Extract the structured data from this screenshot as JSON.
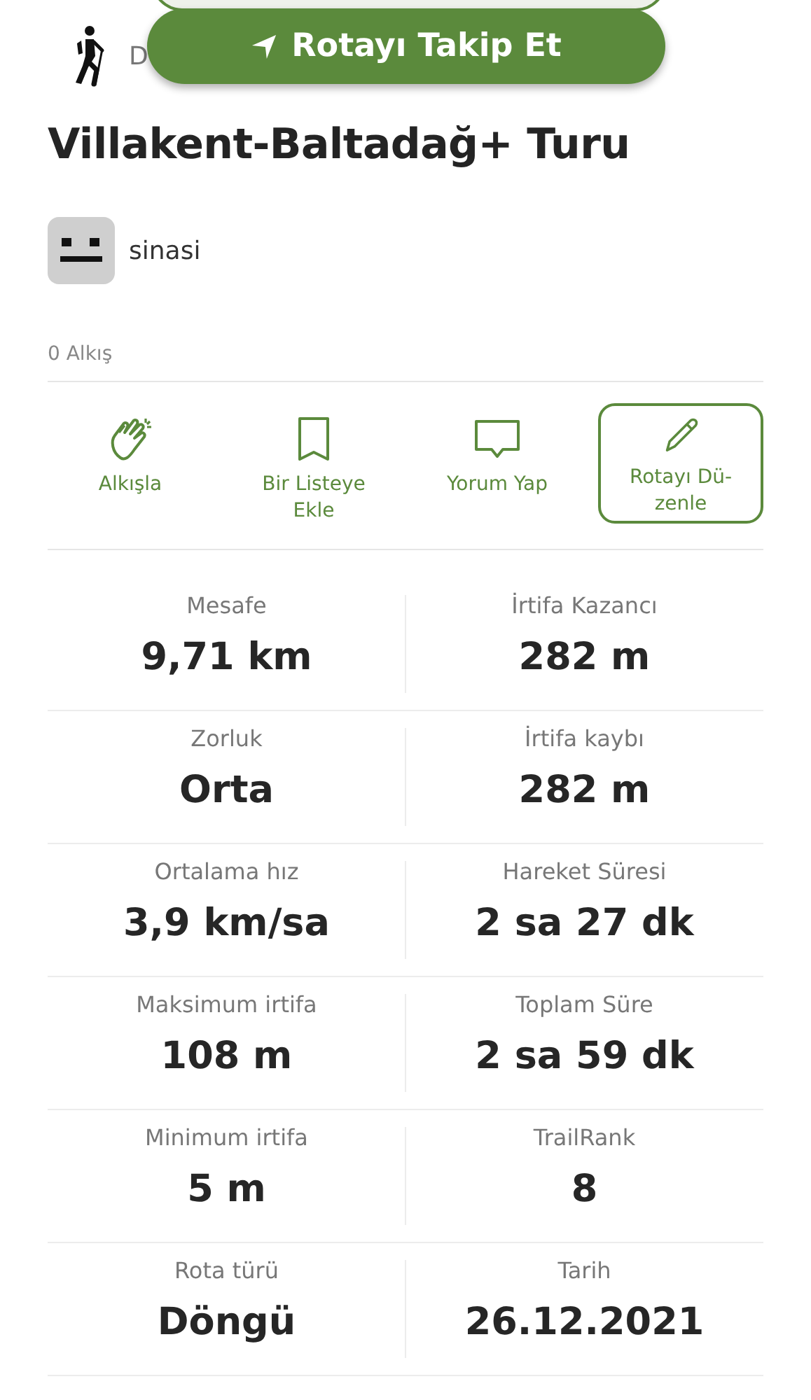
{
  "header": {
    "category": "D",
    "follow_button": {
      "label": "Rotayı Takip Et"
    }
  },
  "title": "Villakent-Baltadağ+ Turu",
  "author": {
    "name": "sinasi"
  },
  "applause_count": "0 Alkış",
  "actions": [
    {
      "kind": "applaud",
      "label": "Alkışla"
    },
    {
      "kind": "save",
      "label": "Bir Listeye Ekle"
    },
    {
      "kind": "comment",
      "label": "Yorum Yap"
    },
    {
      "kind": "edit",
      "label": "Rotayı Dü-zenle"
    }
  ],
  "stats": [
    {
      "label": "Mesafe",
      "value": "9,71 km"
    },
    {
      "label": "İrtifa Kazancı",
      "value": "282 m"
    },
    {
      "label": "Zorluk",
      "value": "Orta"
    },
    {
      "label": "İrtifa kaybı",
      "value": "282 m"
    },
    {
      "label": "Ortalama hız",
      "value": "3,9 km/sa"
    },
    {
      "label": "Hareket Süresi",
      "value": "2 sa 27 dk"
    },
    {
      "label": "Maksimum irtifa",
      "value": "108 m"
    },
    {
      "label": "Toplam Süre",
      "value": "2 sa 59 dk"
    },
    {
      "label": "Minimum irtifa",
      "value": "5 m"
    },
    {
      "label": "TrailRank",
      "value": "8"
    },
    {
      "label": "Rota türü",
      "value": "Döngü"
    },
    {
      "label": "Tarih",
      "value": "26.12.2021"
    }
  ]
}
